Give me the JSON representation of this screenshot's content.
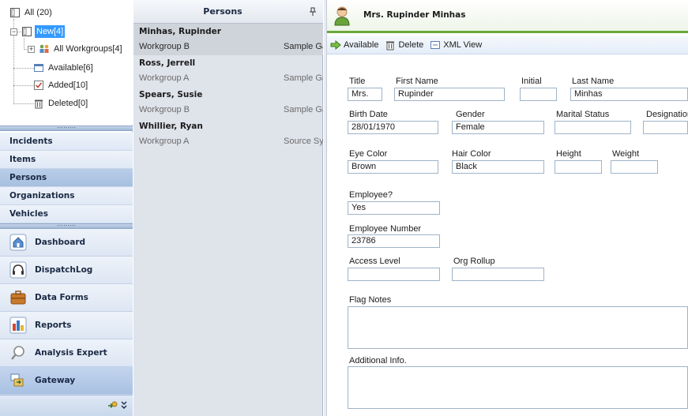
{
  "tree": {
    "all": "All (20)",
    "new": "New[4]",
    "all_workgroups": "All Workgroups[4]",
    "available": "Available[6]",
    "added": "Added[10]",
    "deleted": "Deleted[0]"
  },
  "nav": {
    "links": [
      "Incidents",
      "Items",
      "Persons",
      "Organizations",
      "Vehicles"
    ],
    "active_link": "Persons",
    "buttons": [
      "Dashboard",
      "DispatchLog",
      "Data Forms",
      "Reports",
      "Analysis Expert",
      "Gateway"
    ],
    "active_button": "Gateway",
    "splitter_dots": "·········"
  },
  "persons_panel": {
    "title": "Persons",
    "rows": [
      {
        "name": "Minhas, Rupinder",
        "group": "Workgroup B",
        "source": "Sample Ga"
      },
      {
        "name": "Ross, Jerrell",
        "group": "Workgroup A",
        "source": "Sample Ga"
      },
      {
        "name": "Spears, Susie",
        "group": "Workgroup B",
        "source": "Sample Ga"
      },
      {
        "name": "Whillier, Ryan",
        "group": "Workgroup A",
        "source": "Source Syst"
      }
    ]
  },
  "detail": {
    "header_title": "Mrs. Rupinder Minhas",
    "toolbar": {
      "available": "Available",
      "delete": "Delete",
      "xml_view": "XML View"
    },
    "fields": {
      "title": {
        "label": "Title",
        "value": "Mrs."
      },
      "first_name": {
        "label": "First Name",
        "value": "Rupinder"
      },
      "initial": {
        "label": "Initial",
        "value": ""
      },
      "last_name": {
        "label": "Last Name",
        "value": "Minhas"
      },
      "birth_date": {
        "label": "Birth Date",
        "value": "28/01/1970"
      },
      "gender": {
        "label": "Gender",
        "value": "Female"
      },
      "marital_status": {
        "label": "Marital Status",
        "value": ""
      },
      "designation": {
        "label": "Designation",
        "value": ""
      },
      "eye_color": {
        "label": "Eye Color",
        "value": "Brown"
      },
      "hair_color": {
        "label": "Hair Color",
        "value": "Black"
      },
      "height": {
        "label": "Height",
        "value": ""
      },
      "weight": {
        "label": "Weight",
        "value": ""
      },
      "employee": {
        "label": "Employee?",
        "value": "Yes"
      },
      "employee_number": {
        "label": "Employee Number",
        "value": "23786"
      },
      "access_level": {
        "label": "Access Level",
        "value": ""
      },
      "org_rollup": {
        "label": "Org Rollup",
        "value": ""
      },
      "flag_notes": {
        "label": "Flag Notes",
        "value": ""
      },
      "additional_info": {
        "label": "Additional Info.",
        "value": ""
      }
    }
  },
  "colors": {
    "accent_green": "#69a83a",
    "selection_blue": "#3399ff",
    "nav_active": "#a7c0e0"
  }
}
